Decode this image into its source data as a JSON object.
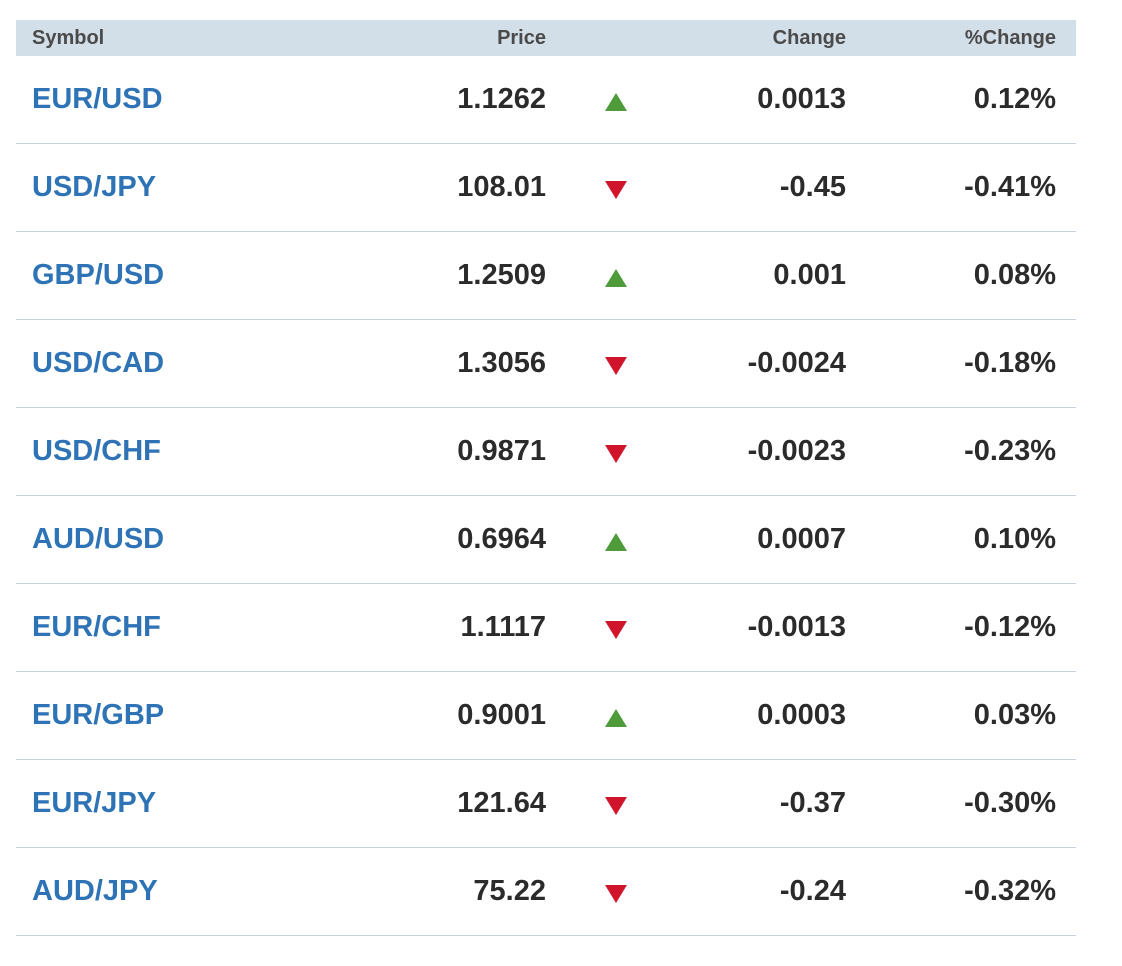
{
  "table": {
    "headers": {
      "symbol": "Symbol",
      "price": "Price",
      "change": "Change",
      "pct_change": "%Change"
    },
    "rows": [
      {
        "symbol": "EUR/USD",
        "price": "1.1262",
        "direction": "up",
        "change": "0.0013",
        "pct_change": "0.12%"
      },
      {
        "symbol": "USD/JPY",
        "price": "108.01",
        "direction": "down",
        "change": "-0.45",
        "pct_change": "-0.41%"
      },
      {
        "symbol": "GBP/USD",
        "price": "1.2509",
        "direction": "up",
        "change": "0.001",
        "pct_change": "0.08%"
      },
      {
        "symbol": "USD/CAD",
        "price": "1.3056",
        "direction": "down",
        "change": "-0.0024",
        "pct_change": "-0.18%"
      },
      {
        "symbol": "USD/CHF",
        "price": "0.9871",
        "direction": "down",
        "change": "-0.0023",
        "pct_change": "-0.23%"
      },
      {
        "symbol": "AUD/USD",
        "price": "0.6964",
        "direction": "up",
        "change": "0.0007",
        "pct_change": "0.10%"
      },
      {
        "symbol": "EUR/CHF",
        "price": "1.1117",
        "direction": "down",
        "change": "-0.0013",
        "pct_change": "-0.12%"
      },
      {
        "symbol": "EUR/GBP",
        "price": "0.9001",
        "direction": "up",
        "change": "0.0003",
        "pct_change": "0.03%"
      },
      {
        "symbol": "EUR/JPY",
        "price": "121.64",
        "direction": "down",
        "change": "-0.37",
        "pct_change": "-0.30%"
      },
      {
        "symbol": "AUD/JPY",
        "price": "75.22",
        "direction": "down",
        "change": "-0.24",
        "pct_change": "-0.32%"
      }
    ]
  },
  "icons": {
    "up": "arrow-up-icon",
    "down": "arrow-down-icon"
  },
  "colors": {
    "symbol_link": "#2e73b5",
    "up": "#4e9b3c",
    "down": "#d0142c",
    "header_bg": "#d3dfe8"
  }
}
